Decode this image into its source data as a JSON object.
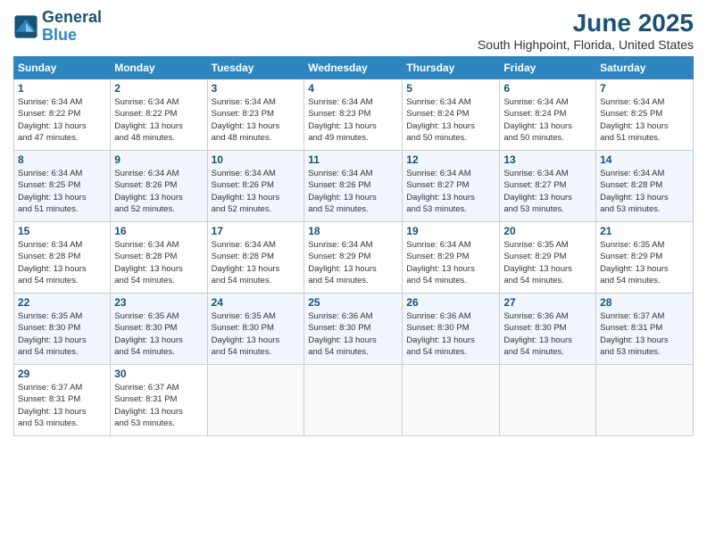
{
  "header": {
    "logo_line1": "General",
    "logo_line2": "Blue",
    "month": "June 2025",
    "location": "South Highpoint, Florida, United States"
  },
  "weekdays": [
    "Sunday",
    "Monday",
    "Tuesday",
    "Wednesday",
    "Thursday",
    "Friday",
    "Saturday"
  ],
  "weeks": [
    [
      {
        "day": "1",
        "info": "Sunrise: 6:34 AM\nSunset: 8:22 PM\nDaylight: 13 hours\nand 47 minutes."
      },
      {
        "day": "2",
        "info": "Sunrise: 6:34 AM\nSunset: 8:22 PM\nDaylight: 13 hours\nand 48 minutes."
      },
      {
        "day": "3",
        "info": "Sunrise: 6:34 AM\nSunset: 8:23 PM\nDaylight: 13 hours\nand 48 minutes."
      },
      {
        "day": "4",
        "info": "Sunrise: 6:34 AM\nSunset: 8:23 PM\nDaylight: 13 hours\nand 49 minutes."
      },
      {
        "day": "5",
        "info": "Sunrise: 6:34 AM\nSunset: 8:24 PM\nDaylight: 13 hours\nand 50 minutes."
      },
      {
        "day": "6",
        "info": "Sunrise: 6:34 AM\nSunset: 8:24 PM\nDaylight: 13 hours\nand 50 minutes."
      },
      {
        "day": "7",
        "info": "Sunrise: 6:34 AM\nSunset: 8:25 PM\nDaylight: 13 hours\nand 51 minutes."
      }
    ],
    [
      {
        "day": "8",
        "info": "Sunrise: 6:34 AM\nSunset: 8:25 PM\nDaylight: 13 hours\nand 51 minutes."
      },
      {
        "day": "9",
        "info": "Sunrise: 6:34 AM\nSunset: 8:26 PM\nDaylight: 13 hours\nand 52 minutes."
      },
      {
        "day": "10",
        "info": "Sunrise: 6:34 AM\nSunset: 8:26 PM\nDaylight: 13 hours\nand 52 minutes."
      },
      {
        "day": "11",
        "info": "Sunrise: 6:34 AM\nSunset: 8:26 PM\nDaylight: 13 hours\nand 52 minutes."
      },
      {
        "day": "12",
        "info": "Sunrise: 6:34 AM\nSunset: 8:27 PM\nDaylight: 13 hours\nand 53 minutes."
      },
      {
        "day": "13",
        "info": "Sunrise: 6:34 AM\nSunset: 8:27 PM\nDaylight: 13 hours\nand 53 minutes."
      },
      {
        "day": "14",
        "info": "Sunrise: 6:34 AM\nSunset: 8:28 PM\nDaylight: 13 hours\nand 53 minutes."
      }
    ],
    [
      {
        "day": "15",
        "info": "Sunrise: 6:34 AM\nSunset: 8:28 PM\nDaylight: 13 hours\nand 54 minutes."
      },
      {
        "day": "16",
        "info": "Sunrise: 6:34 AM\nSunset: 8:28 PM\nDaylight: 13 hours\nand 54 minutes."
      },
      {
        "day": "17",
        "info": "Sunrise: 6:34 AM\nSunset: 8:28 PM\nDaylight: 13 hours\nand 54 minutes."
      },
      {
        "day": "18",
        "info": "Sunrise: 6:34 AM\nSunset: 8:29 PM\nDaylight: 13 hours\nand 54 minutes."
      },
      {
        "day": "19",
        "info": "Sunrise: 6:34 AM\nSunset: 8:29 PM\nDaylight: 13 hours\nand 54 minutes."
      },
      {
        "day": "20",
        "info": "Sunrise: 6:35 AM\nSunset: 8:29 PM\nDaylight: 13 hours\nand 54 minutes."
      },
      {
        "day": "21",
        "info": "Sunrise: 6:35 AM\nSunset: 8:29 PM\nDaylight: 13 hours\nand 54 minutes."
      }
    ],
    [
      {
        "day": "22",
        "info": "Sunrise: 6:35 AM\nSunset: 8:30 PM\nDaylight: 13 hours\nand 54 minutes."
      },
      {
        "day": "23",
        "info": "Sunrise: 6:35 AM\nSunset: 8:30 PM\nDaylight: 13 hours\nand 54 minutes."
      },
      {
        "day": "24",
        "info": "Sunrise: 6:35 AM\nSunset: 8:30 PM\nDaylight: 13 hours\nand 54 minutes."
      },
      {
        "day": "25",
        "info": "Sunrise: 6:36 AM\nSunset: 8:30 PM\nDaylight: 13 hours\nand 54 minutes."
      },
      {
        "day": "26",
        "info": "Sunrise: 6:36 AM\nSunset: 8:30 PM\nDaylight: 13 hours\nand 54 minutes."
      },
      {
        "day": "27",
        "info": "Sunrise: 6:36 AM\nSunset: 8:30 PM\nDaylight: 13 hours\nand 54 minutes."
      },
      {
        "day": "28",
        "info": "Sunrise: 6:37 AM\nSunset: 8:31 PM\nDaylight: 13 hours\nand 53 minutes."
      }
    ],
    [
      {
        "day": "29",
        "info": "Sunrise: 6:37 AM\nSunset: 8:31 PM\nDaylight: 13 hours\nand 53 minutes."
      },
      {
        "day": "30",
        "info": "Sunrise: 6:37 AM\nSunset: 8:31 PM\nDaylight: 13 hours\nand 53 minutes."
      },
      null,
      null,
      null,
      null,
      null
    ]
  ]
}
